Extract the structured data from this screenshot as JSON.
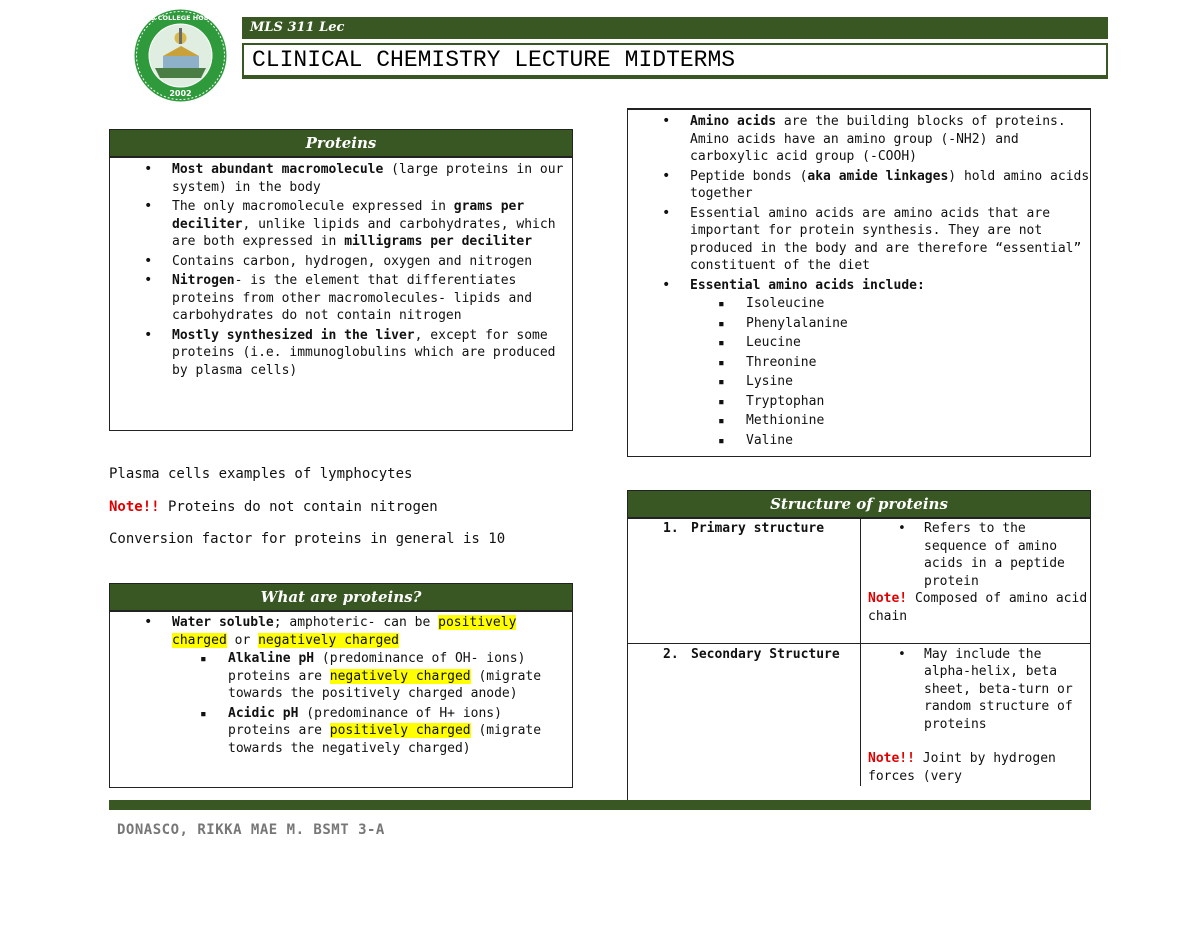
{
  "header": {
    "seal_text": "ST. ANTHONY'S COLLEGE HOSPITAL SCHOOL",
    "seal_year": "2002",
    "course": "MLS 311 Lec",
    "title": "CLINICAL CHEMISTRY LECTURE MIDTERMS"
  },
  "proteins": {
    "heading": "Proteins",
    "b1_bold": "Most abundant macromolecule",
    "b1_rest": " (large proteins in our system) in the body",
    "b2_pre": "The only macromolecule expressed in ",
    "b2_bold1": "grams per deciliter",
    "b2_mid": ", unlike lipids and carbohydrates, which are both expressed in ",
    "b2_bold2": "milligrams per deciliter",
    "b3": "Contains carbon, hydrogen, oxygen and nitrogen",
    "b4_bold": "Nitrogen",
    "b4_rest": "- is the element that differentiates proteins from other macromolecules- lipids and carbohydrates do not contain nitrogen",
    "b5_bold": "Mostly synthesized in the liver",
    "b5_rest": ", except for some proteins (i.e. immunoglobulins which are produced by plasma cells)"
  },
  "notes": {
    "plasma": "Plasma cells examples of lymphocytes",
    "note_label": "Note!!",
    "note_text": " Proteins do not contain nitrogen",
    "conversion": "Conversion factor for proteins in general is 10"
  },
  "what": {
    "heading": "What are proteins?",
    "b1_bold": "Water soluble",
    "b1_mid": "; amphoteric- can be ",
    "b1_hl1": "positively charged",
    "b1_or": " or ",
    "b1_hl2": "negatively charged",
    "s1_bold": "Alkaline pH",
    "s1_mid": " (predominance of OH- ions) proteins are ",
    "s1_hl": "negatively charged",
    "s1_rest": " (migrate towards the positively charged anode)",
    "s2_bold": "Acidic pH",
    "s2_mid": " (predominance of H+ ions) proteins are ",
    "s2_hl": "positively charged",
    "s2_rest": " (migrate towards the negatively charged)"
  },
  "amino": {
    "b1_bold": "Amino acids",
    "b1_rest": " are the building blocks of proteins. Amino acids have an amino group (-NH2) and carboxylic acid group (-COOH)",
    "b2_pre": "Peptide bonds (",
    "b2_bold": "aka amide linkages",
    "b2_rest": ") hold amino acids together",
    "b3": "Essential amino acids are amino acids that are important for protein synthesis. They are not produced in the body and are therefore “essential” constituent of the diet",
    "b4_bold": "Essential amino acids include:",
    "list": [
      "Isoleucine",
      "Phenylalanine",
      "Leucine",
      "Threonine",
      "Lysine",
      "Tryptophan",
      "Methionine",
      "Valine"
    ]
  },
  "structure": {
    "heading": "Structure of proteins",
    "r1_num": "1.",
    "r1_label": "Primary structure",
    "r1_text": "Refers to the sequence of amino acids in a peptide protein",
    "r1_note_label": "Note!",
    "r1_note": " Composed of amino acid chain",
    "r2_num": "2.",
    "r2_label": "Secondary Structure",
    "r2_text": "May include the alpha-helix, beta sheet, beta-turn or random structure of proteins",
    "r2_note_label": "Note!!",
    "r2_note": " Joint by hydrogen forces (very"
  },
  "footer": {
    "name": "DONASCO, RIKKA MAE M. BSMT 3-A"
  },
  "colors": {
    "accent": "#385723",
    "note_red": "#e00000",
    "highlight": "#ffff00"
  }
}
